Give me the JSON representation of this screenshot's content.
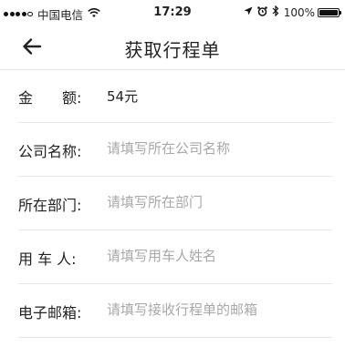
{
  "status_bar": {
    "carrier": "中国电信",
    "time": "17:29",
    "battery": "100%",
    "signal_bars_filled": 4,
    "signal_bars_total": 5
  },
  "nav": {
    "title": "获取行程单",
    "back_icon": "arrow-left-icon"
  },
  "form": {
    "amount": {
      "label": "金　　额:",
      "value": "54元"
    },
    "company": {
      "label": "公司名称:",
      "placeholder": "请填写所在公司名称"
    },
    "department": {
      "label": "所在部门:",
      "placeholder": "请填写所在部门"
    },
    "user": {
      "label": "用 车 人:",
      "placeholder": "请填写用车人姓名"
    },
    "email": {
      "label": "电子邮箱:",
      "placeholder": "请填写接收行程单的邮箱"
    }
  }
}
